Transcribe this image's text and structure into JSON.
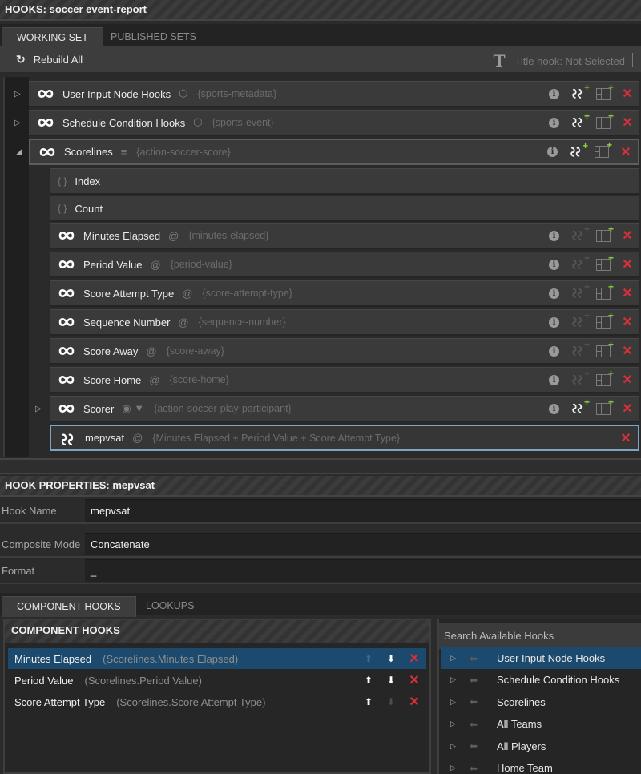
{
  "window": {
    "title": "HOOKS: soccer event-report"
  },
  "top_tabs": [
    {
      "label": "WORKING SET",
      "active": true
    },
    {
      "label": "PUBLISHED SETS",
      "active": false
    }
  ],
  "toolbar": {
    "rebuild_label": "Rebuild All",
    "title_hook_label": "Title hook: Not Selected"
  },
  "tree": {
    "rows": [
      {
        "name": "User Input Node Hooks",
        "type_icon": "cube-icon",
        "binding": "{sports-metadata}",
        "expander": "collapsed"
      },
      {
        "name": "Schedule Condition Hooks",
        "type_icon": "cube-icon",
        "binding": "{sports-event}",
        "expander": "collapsed"
      },
      {
        "name": "Scorelines",
        "type_icon": "stack-icon",
        "binding": "{action-soccer-score}",
        "expander": "expanded"
      },
      {
        "name": "Index",
        "type_icon": "braces-icon"
      },
      {
        "name": "Count",
        "type_icon": "braces-icon"
      },
      {
        "name": "Minutes Elapsed",
        "type_icon": "at-icon",
        "binding": "{minutes-elapsed}"
      },
      {
        "name": "Period Value",
        "type_icon": "at-icon",
        "binding": "{period-value}"
      },
      {
        "name": "Score Attempt Type",
        "type_icon": "at-icon",
        "binding": "{score-attempt-type}"
      },
      {
        "name": "Sequence Number",
        "type_icon": "at-icon",
        "binding": "{sequence-number}"
      },
      {
        "name": "Score Away",
        "type_icon": "at-icon",
        "binding": "{score-away}"
      },
      {
        "name": "Score Home",
        "type_icon": "at-icon",
        "binding": "{score-home}"
      },
      {
        "name": "Scorer",
        "type_icon": "eye-filter-icon",
        "binding": "{action-soccer-play-participant}",
        "expander": "collapsed"
      },
      {
        "name": "mepvsat",
        "type_icon": "at-icon",
        "binding": "{Minutes Elapsed + Period Value + Score Attempt Type}"
      }
    ]
  },
  "hook_properties": {
    "title": "HOOK PROPERTIES: mepvsat",
    "fields": [
      {
        "label": "Hook Name",
        "value": "mepvsat"
      },
      {
        "label": "Composite Mode",
        "value": "Concatenate"
      },
      {
        "label": "Format",
        "value": "_"
      }
    ]
  },
  "bottom_tabs": [
    {
      "label": "COMPONENT HOOKS",
      "active": true
    },
    {
      "label": "LOOKUPS",
      "active": false
    }
  ],
  "component_hooks": {
    "title": "COMPONENT HOOKS",
    "items": [
      {
        "name": "Minutes Elapsed",
        "path": "(Scorelines.Minutes Elapsed)",
        "selected": true
      },
      {
        "name": "Period Value",
        "path": "(Scorelines.Period Value)",
        "selected": false
      },
      {
        "name": "Score Attempt Type",
        "path": "(Scorelines.Score Attempt Type)",
        "selected": false
      }
    ]
  },
  "available_hooks": {
    "search_placeholder": "Search Available Hooks",
    "items": [
      {
        "label": "User Input Node Hooks",
        "selected": true
      },
      {
        "label": "Schedule Condition Hooks",
        "selected": false
      },
      {
        "label": "Scorelines",
        "selected": false
      },
      {
        "label": "All Teams",
        "selected": false
      },
      {
        "label": "All Players",
        "selected": false
      },
      {
        "label": "Home Team",
        "selected": false
      }
    ]
  },
  "colors": {
    "accent_selection": "#1b4a6e",
    "selected_border": "#7ea4c4",
    "delete_red": "#d8303a",
    "add_green": "#8ed23a"
  }
}
